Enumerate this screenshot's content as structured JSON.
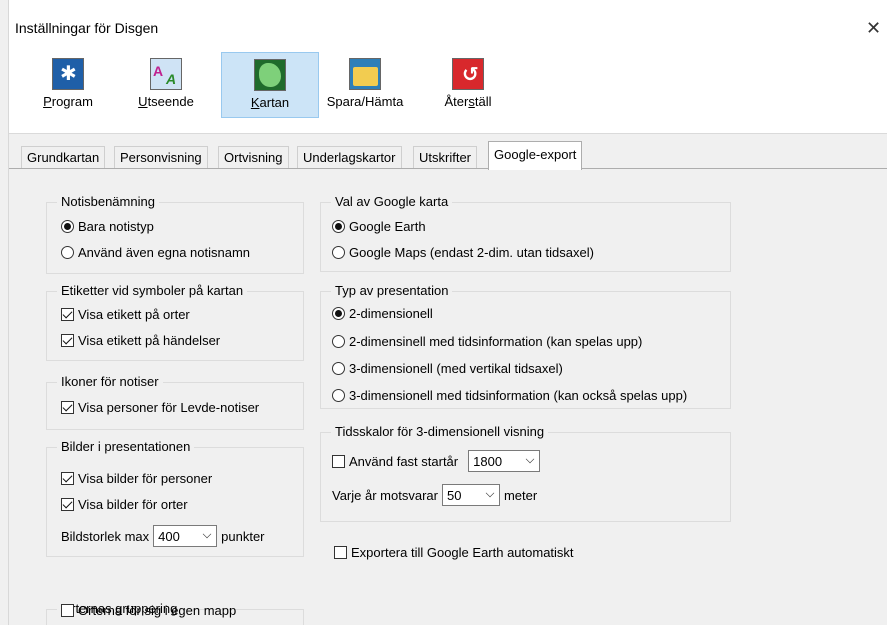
{
  "window": {
    "title": "Inställningar för Disgen",
    "close_icon": "close-icon"
  },
  "toolbar": {
    "buttons": [
      {
        "pre": "",
        "u": "P",
        "post": "rogram",
        "icon": "gear-icon",
        "color": "#1f5fa8"
      },
      {
        "pre": "",
        "u": "U",
        "post": "tseende",
        "icon": "font-icon",
        "color": "#7ab0e0"
      },
      {
        "pre": "",
        "u": "K",
        "post": "artan",
        "icon": "map-icon",
        "color": "#2d7b3a"
      },
      {
        "pre": "Spara/Hämta",
        "u": "",
        "post": "",
        "icon": "folder-icon",
        "color": "#e8c040"
      },
      {
        "pre": "Åter",
        "u": "s",
        "post": "täll",
        "icon": "undo-icon",
        "color": "#d8282c"
      }
    ]
  },
  "tabs": [
    "Grundkartan",
    "Personvisning",
    "Ortvisning",
    "Underlagskartor",
    "Utskrifter",
    "Google-export"
  ],
  "left": {
    "notis": {
      "legend": "Notisbenämning",
      "opt1": "Bara notistyp",
      "opt2": "Använd även egna notisnamn"
    },
    "etiketter": {
      "legend": "Etiketter vid symboler på kartan",
      "c1": "Visa etikett på orter",
      "c2": "Visa etikett på händelser"
    },
    "ikoner": {
      "legend": "Ikoner för notiser",
      "c1": "Visa personer för Levde-notiser"
    },
    "bilder": {
      "legend": "Bilder i presentationen",
      "c1": "Visa bilder för personer",
      "c2": "Visa bilder för orter",
      "size_label": "Bildstorlek  max",
      "size_value": "400",
      "size_unit": "punkter"
    },
    "orter": {
      "legend": "Orternas gruppering",
      "c1": "Orterna för sig i egen mapp"
    }
  },
  "right": {
    "val": {
      "legend": "Val av Google karta",
      "opt1": "Google Earth",
      "opt2": "Google Maps (endast 2-dim. utan tidsaxel)"
    },
    "typ": {
      "legend": "Typ av presentation",
      "opt1": "2-dimensionell",
      "opt2": "2-dimensinell med tidsinformation (kan spelas upp)",
      "opt3": "3-dimensionell (med vertikal tidsaxel)",
      "opt4": "3-dimensionell med tidsinformation (kan också spelas upp)"
    },
    "tid": {
      "legend": "Tidsskalor för 3-dimensionell visning",
      "c1": "Använd fast startår",
      "start_value": "1800",
      "year_label": "Varje år motsvarar",
      "year_value": "50",
      "year_unit": "meter"
    },
    "export": "Exportera till Google Earth automatiskt"
  }
}
